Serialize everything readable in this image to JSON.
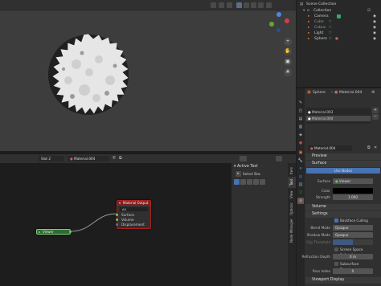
{
  "outliner": {
    "scene_collection": "Scene Collection",
    "items": [
      {
        "label": "Collection"
      },
      {
        "label": "Camera"
      },
      {
        "label": "Cube"
      },
      {
        "label": "Cubus"
      },
      {
        "label": "Light"
      },
      {
        "label": "Sphere"
      }
    ]
  },
  "properties": {
    "object_name": "Sphere",
    "material_name": "Material.004",
    "slots": [
      "Material.003",
      "Material.004"
    ],
    "material_field": "Material.004",
    "sections": {
      "preview": "Preview",
      "surface": "Surface",
      "volume": "Volume",
      "settings": "Settings",
      "viewport_display": "Viewport Display"
    },
    "use_nodes": "Use Nodes",
    "surface_label": "Surface",
    "surface_value": "Viewer",
    "color_label": "Color",
    "strength_label": "Strength",
    "strength_value": "1.000",
    "backface_culling": "Backface Culling",
    "blend_mode_label": "Blend Mode",
    "blend_mode_value": "Opaque",
    "shadow_mode_label": "Shadow Mode",
    "shadow_mode_value": "Opaque",
    "clip_threshold_label": "Clip Threshold",
    "screen_space_refraction": "Screen Space Refraction",
    "refraction_depth_label": "Refraction Depth",
    "refraction_depth_value": "0 m",
    "subsurface_translucency": "Subsurface Translucency",
    "pass_index_label": "Pass Index",
    "pass_index_value": "0"
  },
  "node_editor": {
    "slot": "Slot 2",
    "material": "Material.004",
    "active_tool_header": "Active Tool",
    "select_box": "Select Box",
    "tabs": [
      "Item",
      "Tool",
      "View",
      "Options",
      "Node Wrangler"
    ],
    "viewer_node": "Viewer",
    "output_node": {
      "title": "Material Output",
      "target": "All",
      "inputs": [
        "Surface",
        "Volume",
        "Displacement"
      ]
    }
  }
}
